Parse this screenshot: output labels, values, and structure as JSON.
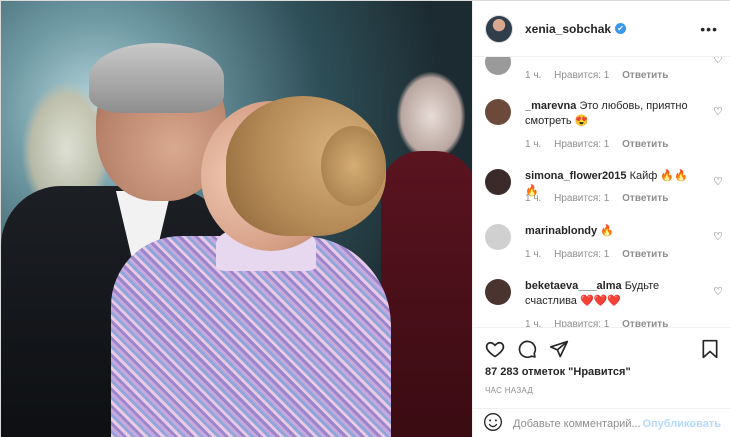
{
  "header": {
    "username": "xenia_sobchak",
    "verified_mark": "✔",
    "more_icon": "more-dots-icon",
    "more_label": "•••"
  },
  "comments": [
    {
      "username": "",
      "text": "",
      "time": "1 ч.",
      "likes": "Нравится: 1",
      "reply": "Ответить",
      "avatar_color": "#9a9a9a"
    },
    {
      "username": "_marevna",
      "text": "Это любовь, приятно смотреть",
      "emoji": "😍",
      "time": "1 ч.",
      "likes": "Нравится: 1",
      "reply": "Ответить",
      "avatar_color": "#6b4a3c"
    },
    {
      "username": "simona_flower2015",
      "text": "Кайф",
      "emoji": "🔥🔥🔥",
      "time": "1 ч.",
      "likes": "Нравится: 1",
      "reply": "Ответить",
      "avatar_color": "#3a2a2a"
    },
    {
      "username": "marinablondy",
      "text": "",
      "emoji": "🔥",
      "time": "1 ч.",
      "likes": "Нравится: 1",
      "reply": "Ответить",
      "avatar_color": "#d0d0d0"
    },
    {
      "username": "beketaeva___alma",
      "text": "Будьте счастлива",
      "emoji": "❤️❤️❤️",
      "time": "1 ч.",
      "likes": "Нравится: 1",
      "reply": "Ответить",
      "avatar_color": "#4a3430"
    }
  ],
  "actions": {
    "likes_text": "87 283 отметок \"Нравится\"",
    "time_ago": "ЧАС НАЗАД",
    "icons": [
      "heart-icon",
      "comment-icon",
      "share-icon",
      "bookmark-icon"
    ]
  },
  "add_comment": {
    "placeholder": "Добавьте комментарий...",
    "post_label": "Опубликовать",
    "emoji_icon": "smiley-icon"
  },
  "colors": {
    "link_blue": "#b3dbff",
    "verified": "#3897f0",
    "muted": "#8e8e8e"
  }
}
